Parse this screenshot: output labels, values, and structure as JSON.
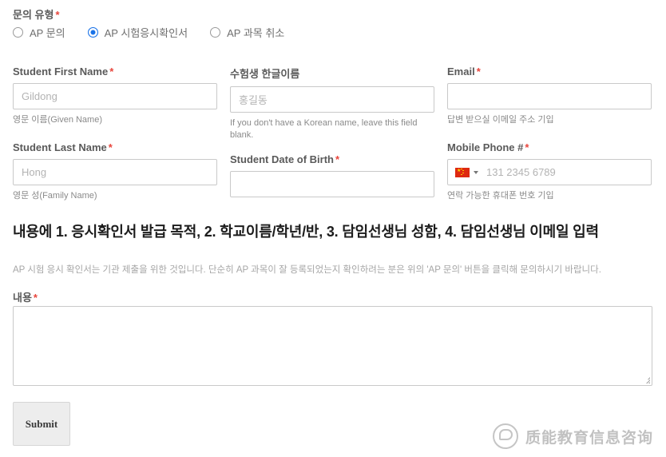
{
  "form": {
    "inquiry_type": {
      "label": "문의 유형",
      "required_mark": "*",
      "options": [
        {
          "label": "AP 문의",
          "selected": false
        },
        {
          "label": "AP 시험응시확인서",
          "selected": true
        },
        {
          "label": "AP 과목 취소",
          "selected": false
        }
      ]
    },
    "fields": {
      "first_name": {
        "label": "Student First Name",
        "required_mark": "*",
        "value": "",
        "placeholder": "Gildong",
        "helper": "영문 이름(Given Name)"
      },
      "korean_name": {
        "label": "수험생 한글이름",
        "required_mark": "",
        "value": "",
        "placeholder": "홍길동",
        "helper": "If you don't have a Korean name, leave this field blank."
      },
      "email": {
        "label": "Email",
        "required_mark": "*",
        "value": "",
        "placeholder": "",
        "helper": "답변 받으실 이메일 주소 기입"
      },
      "last_name": {
        "label": "Student Last Name",
        "required_mark": "*",
        "value": "",
        "placeholder": "Hong",
        "helper": "영문 성(Family Name)"
      },
      "dob": {
        "label": "Student Date of Birth",
        "required_mark": "*",
        "value": "",
        "placeholder": "",
        "helper": ""
      },
      "mobile": {
        "label": "Mobile Phone #",
        "required_mark": "*",
        "value": "",
        "placeholder": "131 2345 6789",
        "helper": "연락 가능한 휴대폰 번호 기입",
        "country_flag": "china-flag-icon"
      },
      "content": {
        "label": "내용",
        "required_mark": "*",
        "value": ""
      }
    },
    "instruction_heading": "내용에 1. 응시확인서 발급 목적, 2. 학교이름/학년/반, 3. 담임선생님 성함, 4. 담임선생님 이메일 입력",
    "instruction_note": "AP 시험 응시 확인서는 기관 제출을 위한 것입니다. 단순히 AP 과목이 잘 등록되었는지 확인하려는 분은 위의 'AP 문의' 버튼을 클릭해 문의하시기 바랍니다.",
    "submit_label": "Submit"
  },
  "watermark": {
    "text": "质能教育信息咨询",
    "logo": "speech-bubble-logo"
  },
  "colors": {
    "accent_blue": "#1a73e8",
    "required_red": "#e8453c",
    "border_grey": "#c9c9c9",
    "label_grey": "#5a5a5a",
    "placeholder_grey": "#b3b3b3",
    "flag_red": "#de2910",
    "flag_yellow": "#ffde00"
  }
}
